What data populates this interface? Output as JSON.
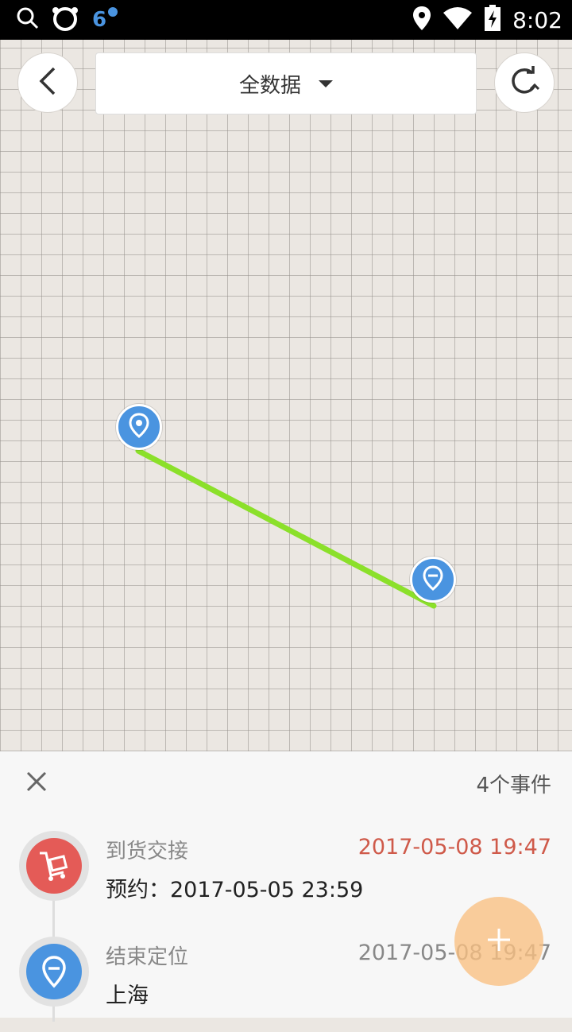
{
  "status_bar": {
    "time": "8:02",
    "left_icons": [
      "search-icon",
      "bear-app-icon",
      "360-app-icon"
    ],
    "right_icons": [
      "location-icon",
      "wifi-icon",
      "battery-charging-icon"
    ]
  },
  "map": {
    "filter_dropdown": {
      "selected": "全数据"
    },
    "back_icon": "chevron-left-icon",
    "refresh_icon": "refresh-icon",
    "route_color": "#8be02a",
    "marker_color": "#4a94e0"
  },
  "panel": {
    "event_count": "4个事件",
    "events": [
      {
        "title": "到货交接",
        "time": "2017-05-08 19:47",
        "time_color": "#cf5a4a",
        "detail": "预约：2017-05-05 23:59",
        "icon": "cart-icon",
        "icon_color": "#e45b57"
      },
      {
        "title": "结束定位",
        "time": "2017-05-08 19:47",
        "time_color": "#888888",
        "detail": "上海",
        "icon": "location-end-icon",
        "icon_color": "#4a94e0"
      }
    ]
  },
  "fab": {
    "icon": "plus-icon",
    "color": "#fac082"
  }
}
